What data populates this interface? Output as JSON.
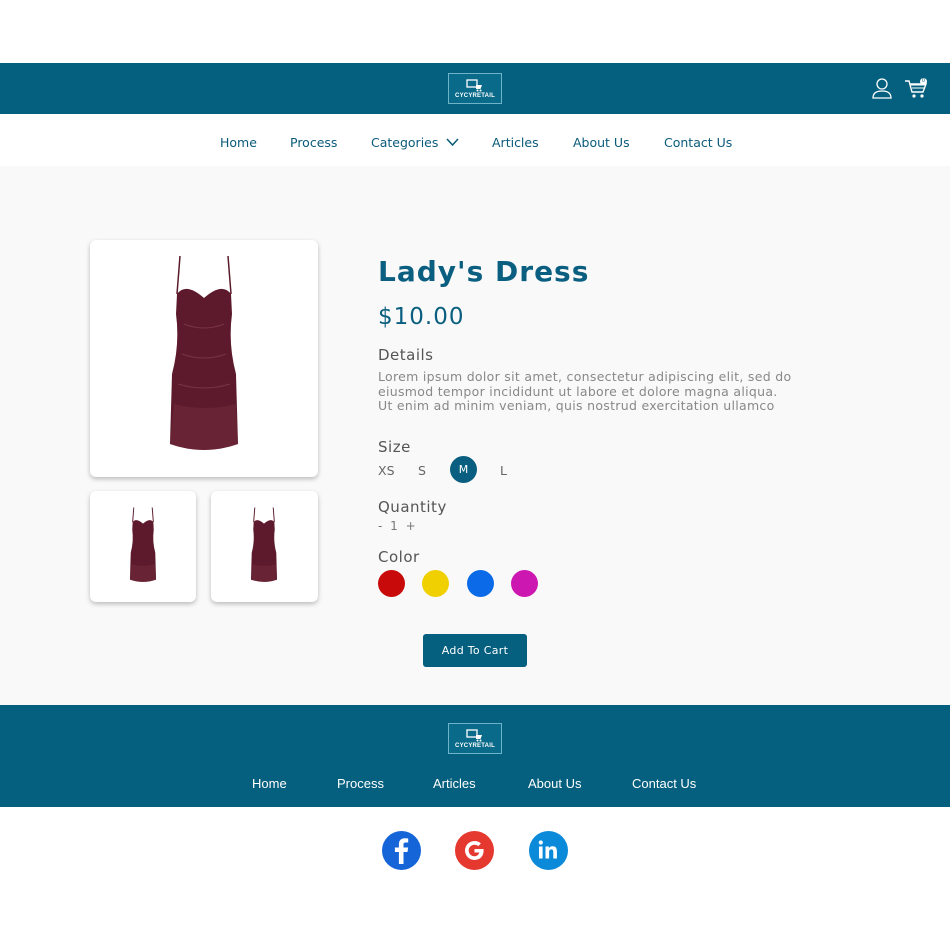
{
  "brand": {
    "name": "CYCYRETAIL"
  },
  "header": {
    "cart_count": "0"
  },
  "nav": {
    "home": "Home",
    "process": "Process",
    "categories": "Categories",
    "articles": "Articles",
    "about": "About Us",
    "contact": "Contact Us"
  },
  "product": {
    "title": "Lady's Dress",
    "price": "$10.00",
    "details_label": "Details",
    "description_lines": [
      "Lorem ipsum dolor sit amet, consectetur adipiscing elit, sed do",
      "eiusmod tempor incididunt ut labore et dolore magna aliqua.",
      "Ut enim ad minim veniam, quis nostrud exercitation ullamco"
    ],
    "size_label": "Size",
    "sizes": [
      "XS",
      "S",
      "M",
      "L"
    ],
    "selected_size": "M",
    "quantity_label": "Quantity",
    "quantity": {
      "minus": "-",
      "value": "1",
      "plus": "+"
    },
    "color_label": "Color",
    "colors": [
      "#c80a0a",
      "#f0d000",
      "#0a6ae8",
      "#cc18b0"
    ],
    "add_to_cart": "Add To Cart"
  },
  "footer": {
    "home": "Home",
    "process": "Process",
    "articles": "Articles",
    "about": "About Us",
    "contact": "Contact Us"
  },
  "social": [
    {
      "name": "facebook-icon",
      "color": "#1565d8"
    },
    {
      "name": "google-icon",
      "color": "#e5382f"
    },
    {
      "name": "linkedin-icon",
      "color": "#0a8ad8"
    }
  ]
}
